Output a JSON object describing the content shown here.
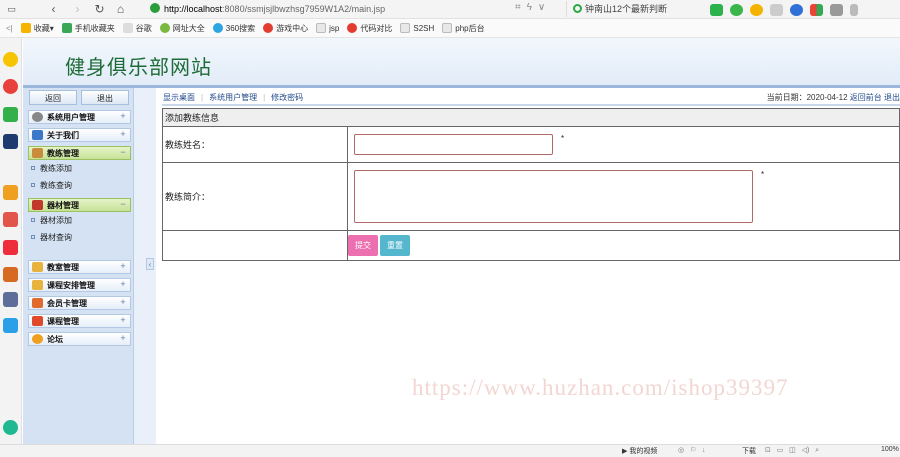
{
  "browser": {
    "url_host": "http://localhost",
    "url_path": ":8080/ssmjsjlbwzhsg7959W1A2/main.jsp",
    "search_text": "钟南山12个最新判断",
    "bookmarks": [
      "收藏",
      "手机收藏夹",
      "谷歌",
      "网址大全",
      "360搜索",
      "游戏中心",
      "jsp",
      "代码对比",
      "S2SH",
      "php后台"
    ]
  },
  "site": {
    "title": "健身俱乐部网站"
  },
  "sidebar": {
    "back_label": "返回",
    "logout_label": "退出",
    "groups": [
      {
        "label": "系统用户管理",
        "expanded": false
      },
      {
        "label": "关于我们",
        "expanded": false
      },
      {
        "label": "教练管理",
        "expanded": true,
        "items": [
          "教练添加",
          "教练查询"
        ]
      },
      {
        "label": "器材管理",
        "expanded": true,
        "items": [
          "器材添加",
          "器材查询"
        ]
      },
      {
        "label": "教室管理",
        "expanded": false
      },
      {
        "label": "课程安排管理",
        "expanded": false
      },
      {
        "label": "会员卡管理",
        "expanded": false
      },
      {
        "label": "课程管理",
        "expanded": false
      },
      {
        "label": "论坛",
        "expanded": false
      }
    ]
  },
  "content": {
    "crumbs": [
      "显示桌面",
      "系统用户管理",
      "修改密码"
    ],
    "date_label": "当前日期：2020-04-12",
    "date_links": [
      "返回前台",
      "退出"
    ],
    "form": {
      "title": "添加教练信息",
      "name_label": "教练姓名：",
      "intro_label": "教练简介：",
      "required_mark": "*",
      "submit_label": "提交",
      "reset_label": "重置"
    }
  },
  "watermark": "https://www.huzhan.com/ishop39397",
  "statusbar": {
    "video": "我的视频",
    "download": "下载",
    "zoom": "100%"
  }
}
